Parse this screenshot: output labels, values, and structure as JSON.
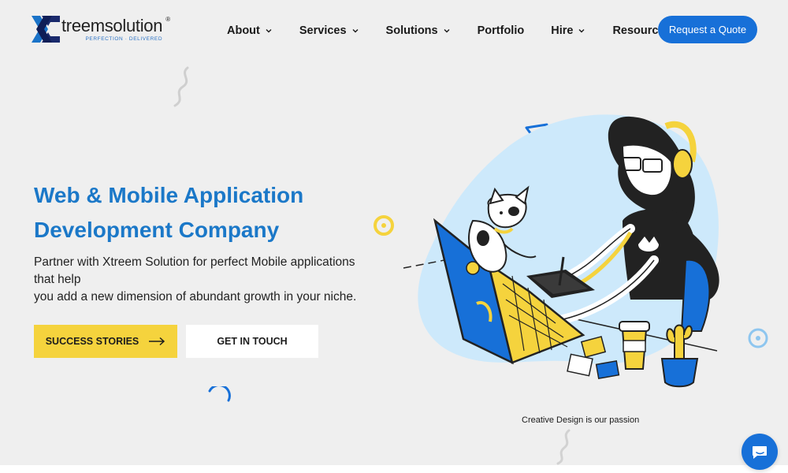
{
  "header": {
    "brand": {
      "name": "treemsolution",
      "registered": "®",
      "tagline": "PERFECTION · DELIVERED"
    },
    "nav": [
      {
        "label": "About",
        "dropdown": true
      },
      {
        "label": "Services",
        "dropdown": true
      },
      {
        "label": "Solutions",
        "dropdown": true
      },
      {
        "label": "Portfolio",
        "dropdown": false
      },
      {
        "label": "Hire",
        "dropdown": true
      },
      {
        "label": "Resources",
        "dropdown": true
      }
    ],
    "cta_label": "Request a Quote"
  },
  "hero": {
    "title_line1": "Web & Mobile Application",
    "title_line2": "Development Company",
    "desc_line1": "Partner with Xtreem Solution for perfect Mobile applications",
    "desc_line2": "that help",
    "desc_line3": "you add a new dimension of abundant growth in your niche.",
    "primary_button": "SUCCESS STORIES",
    "secondary_button": "GET IN TOUCH",
    "illustration_caption": "Creative Design is our passion"
  },
  "icons": {
    "logo": "xtreem-x-logo",
    "chevron": "chevron-down-icon",
    "arrow": "arrow-right-icon",
    "chat": "chat-bubble-icon"
  },
  "colors": {
    "brand_blue": "#1770d8",
    "heading_blue": "#1b78c8",
    "accent_yellow": "#f5d33d",
    "background": "#efefef",
    "blob": "#cde9fb"
  }
}
